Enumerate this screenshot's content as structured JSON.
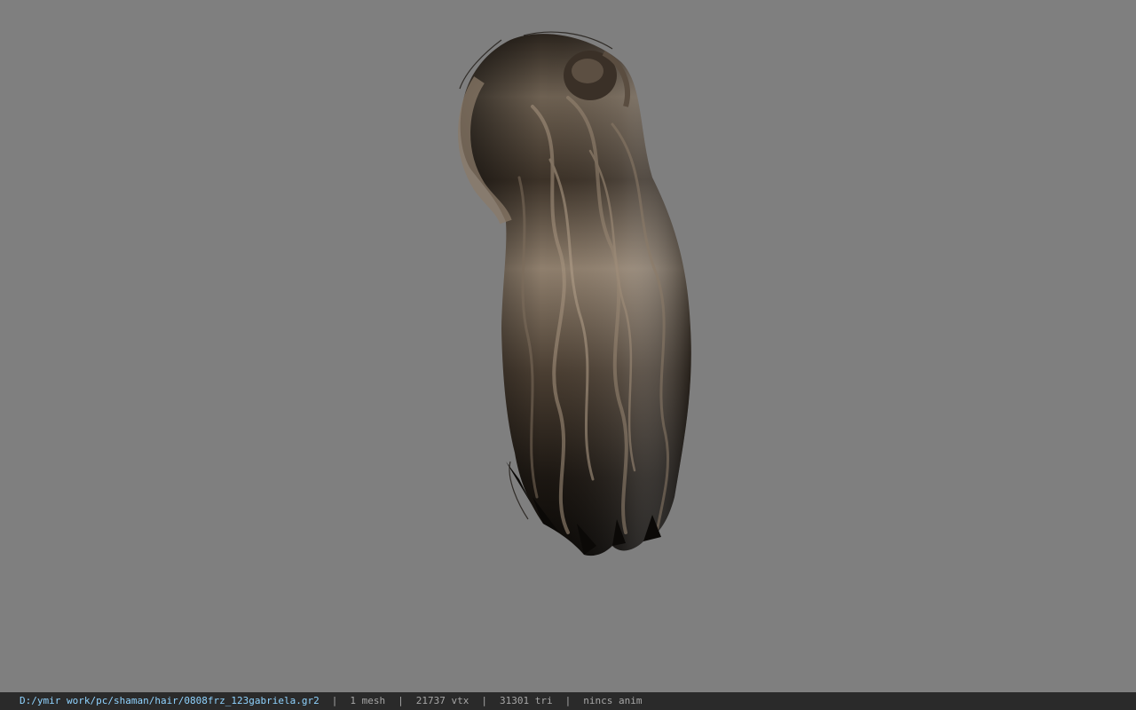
{
  "status_bar": {
    "file_path": "D:/ymir work/pc/shaman/hair/0808frz_123gabriela.gr2",
    "separator": "|",
    "mesh_count": "1 mesh",
    "vertex_count": "21737 vtx",
    "triangle_count": "31301 tri",
    "animation_status": "nincs anim"
  },
  "viewport": {
    "background_color": "#7f7f7f",
    "model_icon": "hair-model-icon"
  },
  "colors": {
    "path_text": "#8fd3ff",
    "status_text": "#a6a6a6",
    "status_background": "#2a2a2a"
  }
}
